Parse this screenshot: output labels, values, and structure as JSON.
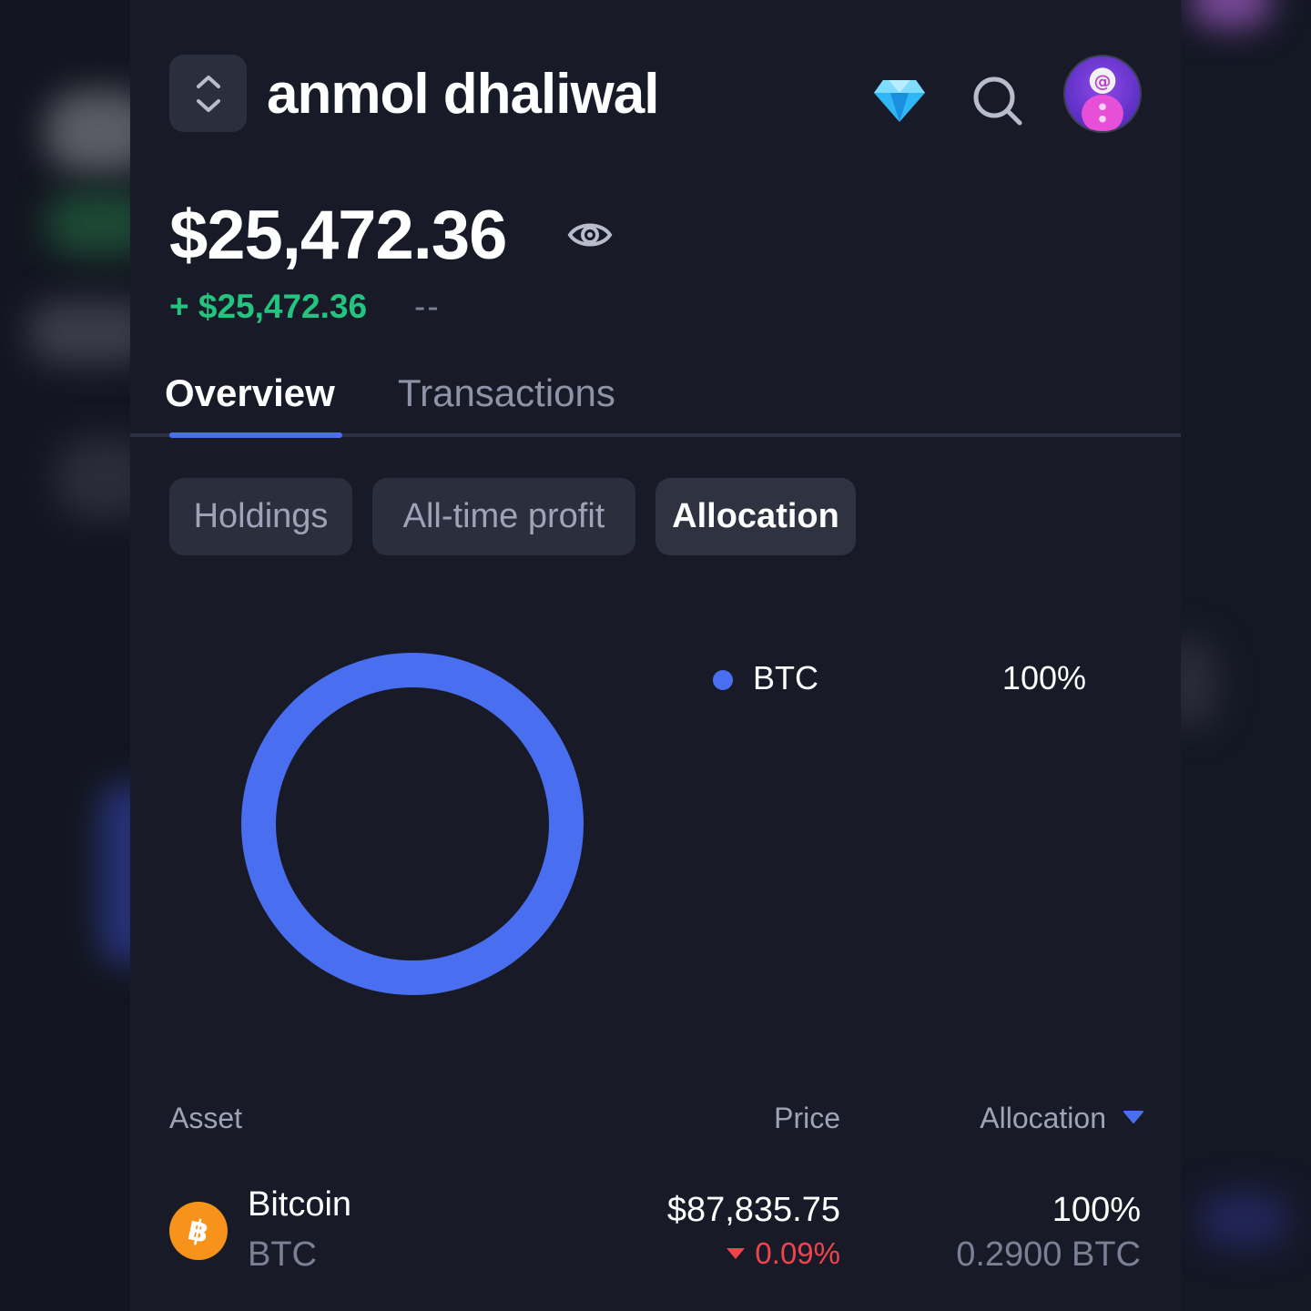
{
  "header": {
    "account_name": "anmol dhaliwal",
    "icons": [
      "account-switcher-icon",
      "diamond-icon",
      "search-icon",
      "avatar"
    ]
  },
  "balance": {
    "total": "$25,472.36",
    "change_amount": "+ $25,472.36",
    "change_percent": "--"
  },
  "tabs": {
    "overview": "Overview",
    "transactions": "Transactions",
    "active": "Overview"
  },
  "filters": {
    "holdings": "Holdings",
    "all_time_profit": "All-time profit",
    "allocation": "Allocation",
    "active": "Allocation"
  },
  "chart_data": {
    "type": "pie",
    "categories": [
      "BTC"
    ],
    "values": [
      100
    ],
    "legend": [
      {
        "label": "BTC",
        "value": "100%",
        "color": "#4a6ef0"
      }
    ]
  },
  "table": {
    "headers": {
      "asset": "Asset",
      "price": "Price",
      "allocation": "Allocation"
    },
    "rows": [
      {
        "name": "Bitcoin",
        "symbol": "BTC",
        "price": "$87,835.75",
        "change": "0.09%",
        "allocation": "100%",
        "amount": "0.2900 BTC"
      }
    ]
  },
  "colors": {
    "accent": "#4a6ef0",
    "positive": "#22c47f",
    "negative": "#f0434e",
    "bitcoin": "#f7931a"
  }
}
